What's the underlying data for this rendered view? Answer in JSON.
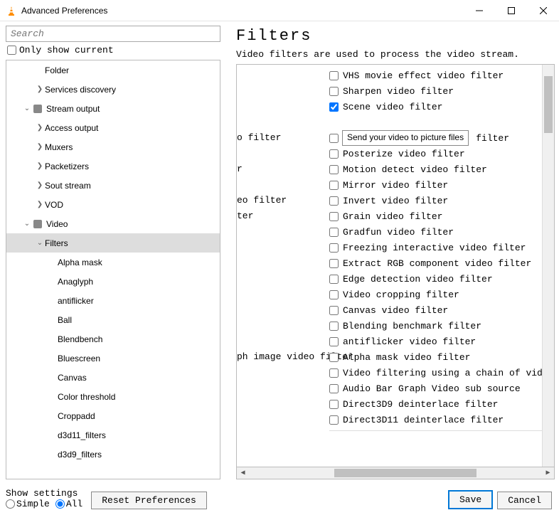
{
  "window": {
    "title": "Advanced Preferences"
  },
  "left": {
    "search_placeholder": "Search",
    "only_show_current": "Only show current",
    "tree": [
      {
        "label": "Folder",
        "indent": 2,
        "arrow": ""
      },
      {
        "label": "Services discovery",
        "indent": 2,
        "arrow": ">"
      },
      {
        "label": "Stream output",
        "indent": 1,
        "arrow": "v",
        "icon": true
      },
      {
        "label": "Access output",
        "indent": 2,
        "arrow": ">"
      },
      {
        "label": "Muxers",
        "indent": 2,
        "arrow": ">"
      },
      {
        "label": "Packetizers",
        "indent": 2,
        "arrow": ">"
      },
      {
        "label": "Sout stream",
        "indent": 2,
        "arrow": ">"
      },
      {
        "label": "VOD",
        "indent": 2,
        "arrow": ">"
      },
      {
        "label": "Video",
        "indent": 1,
        "arrow": "v",
        "icon": true
      },
      {
        "label": "Filters",
        "indent": 2,
        "arrow": "v",
        "selected": true
      },
      {
        "label": "Alpha mask",
        "indent": 3,
        "arrow": ""
      },
      {
        "label": "Anaglyph",
        "indent": 3,
        "arrow": ""
      },
      {
        "label": "antiflicker",
        "indent": 3,
        "arrow": ""
      },
      {
        "label": "Ball",
        "indent": 3,
        "arrow": ""
      },
      {
        "label": "Blendbench",
        "indent": 3,
        "arrow": ""
      },
      {
        "label": "Bluescreen",
        "indent": 3,
        "arrow": ""
      },
      {
        "label": "Canvas",
        "indent": 3,
        "arrow": ""
      },
      {
        "label": "Color threshold",
        "indent": 3,
        "arrow": ""
      },
      {
        "label": "Croppadd",
        "indent": 3,
        "arrow": ""
      },
      {
        "label": "d3d11_filters",
        "indent": 3,
        "arrow": ""
      },
      {
        "label": "d3d9_filters",
        "indent": 3,
        "arrow": ""
      }
    ]
  },
  "right": {
    "title": "Filters",
    "description": "Video filters are used to process the video stream.",
    "left_labels": [
      "",
      "",
      "",
      "",
      "o filter",
      "",
      "r",
      "",
      "eo filter",
      "ter",
      "",
      "",
      "",
      "",
      "",
      "",
      "",
      "",
      "ph image video filter",
      "",
      "",
      "",
      ""
    ],
    "checks": [
      {
        "label": "VHS movie effect video filter",
        "checked": false
      },
      {
        "label": "Sharpen video filter",
        "checked": false
      },
      {
        "label": "Scene video filter",
        "checked": true
      },
      {
        "label": "",
        "checked": false,
        "hidden": true
      },
      {
        "label": "                        filter",
        "checked": false,
        "partial": true
      },
      {
        "label": "Posterize video filter",
        "checked": false
      },
      {
        "label": "Motion detect video filter",
        "checked": false
      },
      {
        "label": "Mirror video filter",
        "checked": false
      },
      {
        "label": "Invert video filter",
        "checked": false
      },
      {
        "label": "Grain video filter",
        "checked": false
      },
      {
        "label": "Gradfun video filter",
        "checked": false
      },
      {
        "label": "Freezing interactive video filter",
        "checked": false
      },
      {
        "label": "Extract RGB component video filter",
        "checked": false
      },
      {
        "label": "Edge detection video filter",
        "checked": false
      },
      {
        "label": "Video cropping filter",
        "checked": false
      },
      {
        "label": "Canvas video filter",
        "checked": false
      },
      {
        "label": "Blending benchmark filter",
        "checked": false
      },
      {
        "label": "antiflicker video filter",
        "checked": false
      },
      {
        "label": "Alpha mask video filter",
        "checked": false
      },
      {
        "label": "Video filtering using a chain of video filter",
        "checked": false
      },
      {
        "label": "Audio Bar Graph Video sub source",
        "checked": false
      },
      {
        "label": "Direct3D9 deinterlace filter",
        "checked": false
      },
      {
        "label": "Direct3D11 deinterlace filter",
        "checked": false
      }
    ],
    "tooltip": "Send your video to picture files"
  },
  "bottom": {
    "show_settings_label": "Show settings",
    "radio_simple": "Simple",
    "radio_all": "All",
    "reset": "Reset Preferences",
    "save": "Save",
    "cancel": "Cancel"
  }
}
